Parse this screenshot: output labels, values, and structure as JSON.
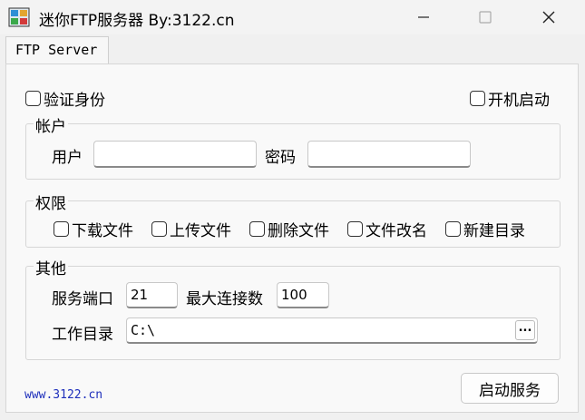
{
  "window": {
    "title": "迷你FTP服务器  By:3122.cn",
    "minimize_glyph": "—",
    "maximize_glyph": "☐",
    "close_glyph": "✕"
  },
  "tabs": [
    {
      "label": "FTP Server",
      "active": true
    }
  ],
  "options": {
    "verify_identity": {
      "label": "验证身份",
      "checked": false
    },
    "autostart": {
      "label": "开机启动",
      "checked": false
    }
  },
  "account": {
    "title": "帐户",
    "user_label": "用户",
    "user_value": "",
    "password_label": "密码",
    "password_value": ""
  },
  "permissions": {
    "title": "权限",
    "items": [
      {
        "label": "下载文件",
        "checked": false
      },
      {
        "label": "上传文件",
        "checked": false
      },
      {
        "label": "删除文件",
        "checked": false
      },
      {
        "label": "文件改名",
        "checked": false
      },
      {
        "label": "新建目录",
        "checked": false
      }
    ]
  },
  "other": {
    "title": "其他",
    "port_label": "服务端口",
    "port_value": "21",
    "maxconn_label": "最大连接数",
    "maxconn_value": "100",
    "workdir_label": "工作目录",
    "workdir_value": "C:\\",
    "browse_label": "..."
  },
  "footer": {
    "link": "www.3122.cn",
    "start_button": "启动服务"
  },
  "colors": {
    "link": "#1e2fbb",
    "background": "#f0f0f0"
  },
  "icons": {
    "app": "app-icon",
    "browse": "ellipsis-icon"
  }
}
